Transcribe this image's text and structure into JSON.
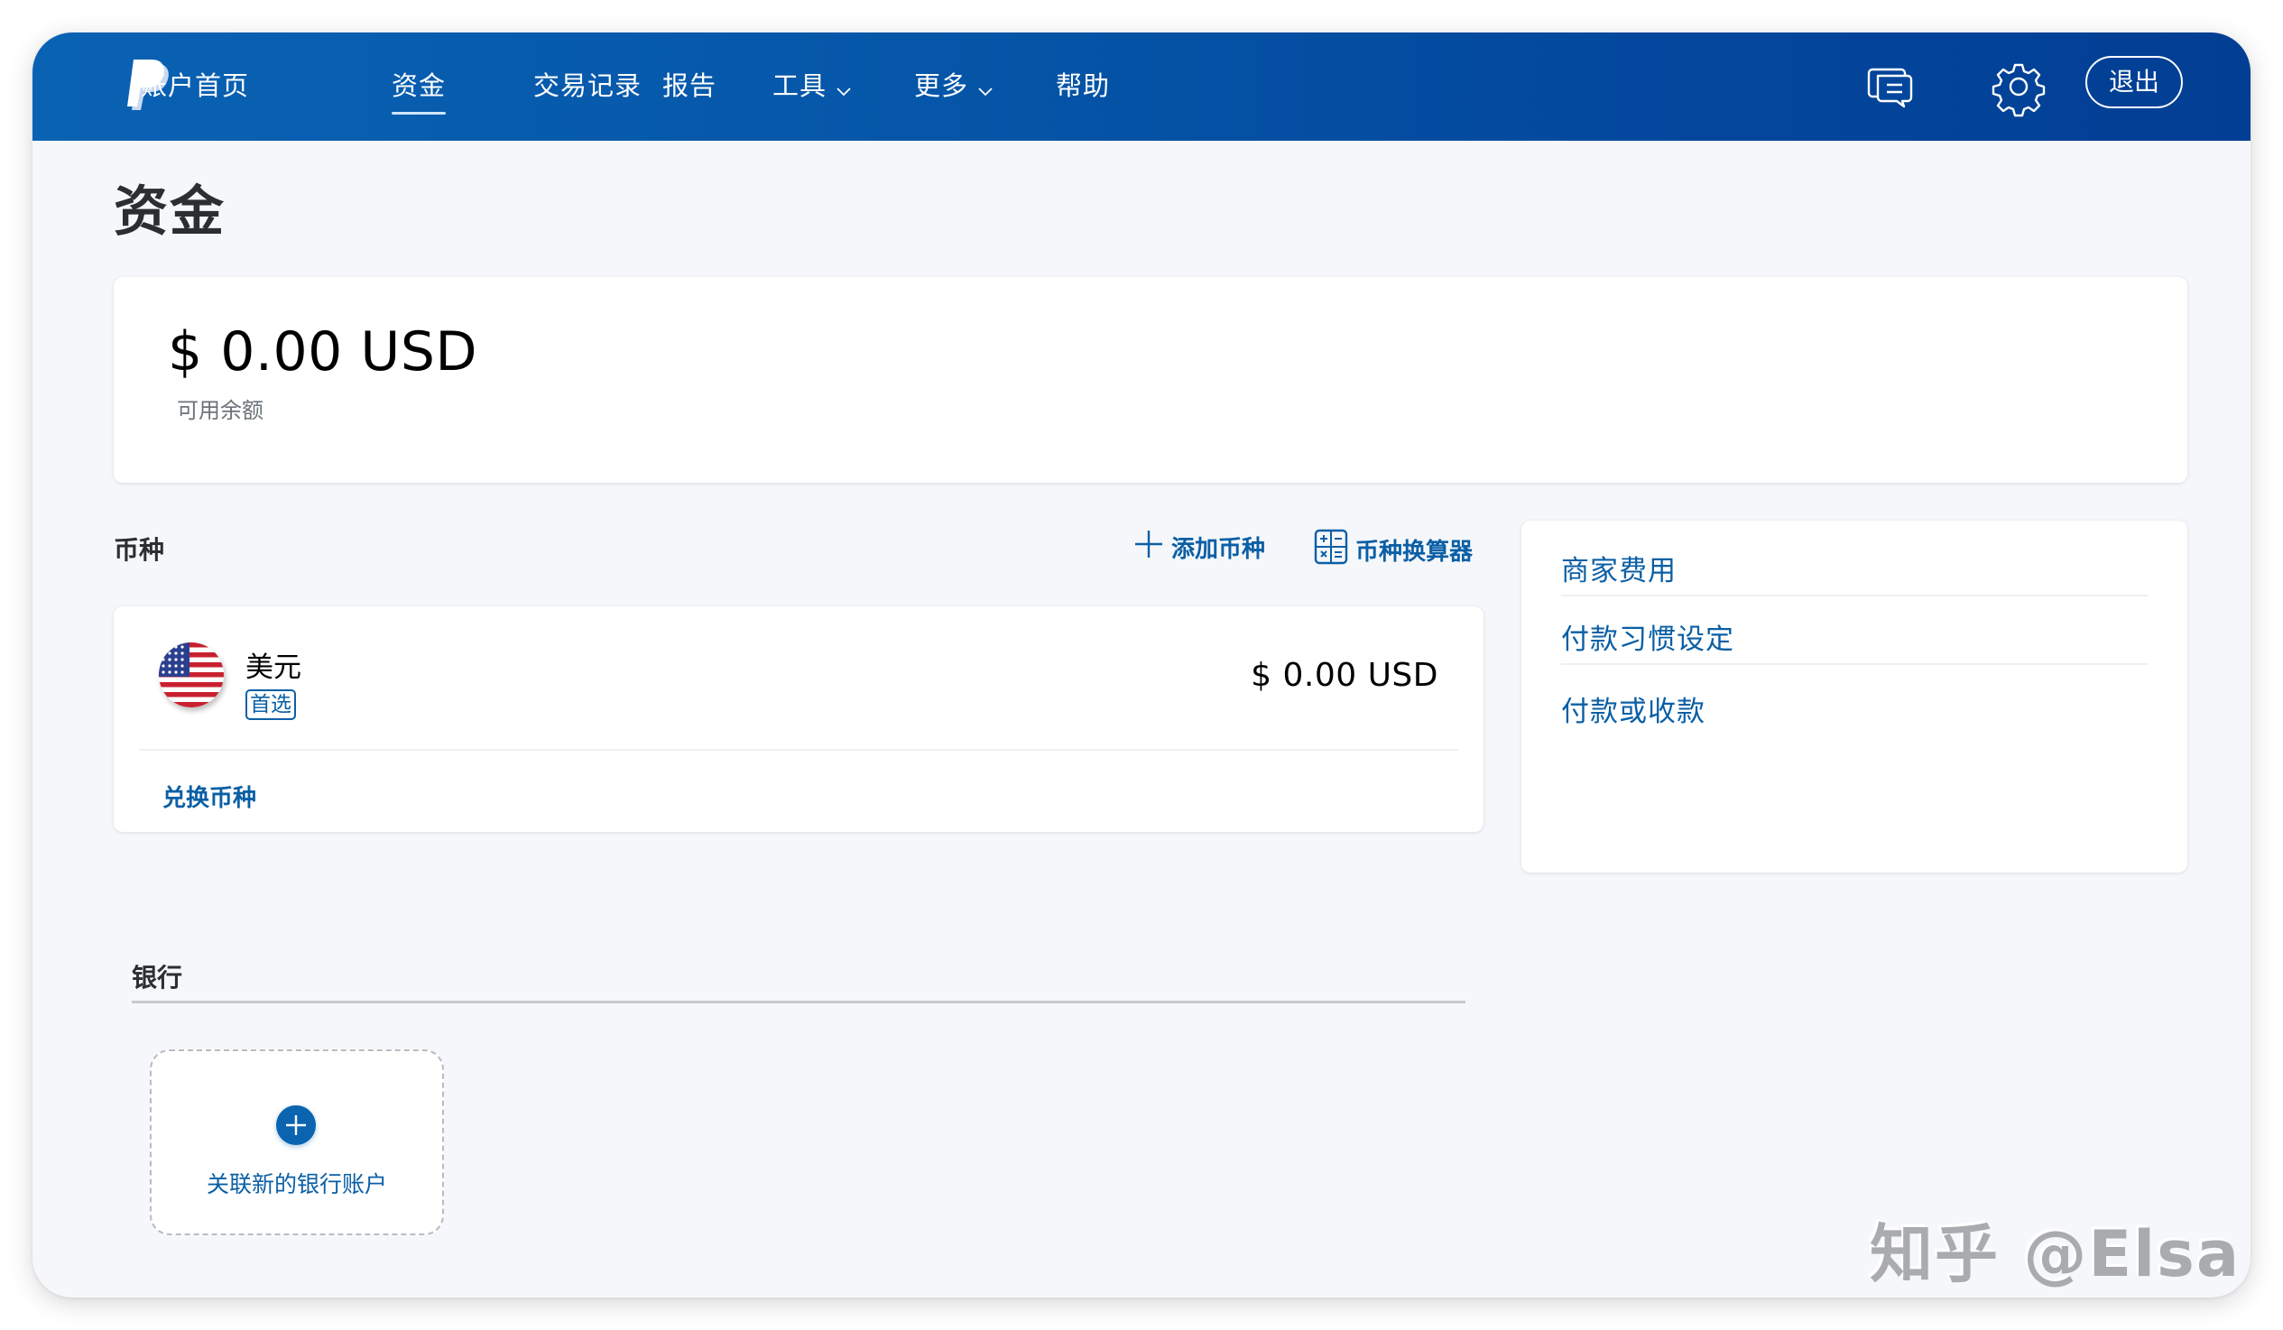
{
  "nav": {
    "brand": "PayPal",
    "items": [
      {
        "label": "账户首页",
        "active": false
      },
      {
        "label": "资金",
        "active": true
      },
      {
        "label": "交易记录",
        "active": false
      },
      {
        "label": "报告",
        "active": false
      },
      {
        "label": "工具",
        "active": false,
        "dropdown": true
      },
      {
        "label": "更多",
        "active": false,
        "dropdown": true
      },
      {
        "label": "帮助",
        "active": false
      }
    ],
    "icons": {
      "messages": "message-center-icon",
      "settings": "gear-icon"
    },
    "logout_label": "退出"
  },
  "page": {
    "title": "资金"
  },
  "balance": {
    "amount": "$ 0.00 USD",
    "label": "可用余额"
  },
  "currencies": {
    "heading": "币种",
    "add_label": "添加币种",
    "converter_label": "币种换算器",
    "items": [
      {
        "name": "美元",
        "badge": "首选",
        "amount": "$ 0.00 USD",
        "flag": "us-flag"
      }
    ],
    "convert_label": "兑换币种"
  },
  "side_links": [
    {
      "label": "商家费用"
    },
    {
      "label": "付款习惯设定"
    },
    {
      "label": "付款或收款"
    }
  ],
  "banks": {
    "heading": "银行",
    "add_label": "关联新的银行账户"
  },
  "watermark": "知乎 @Elsa",
  "colors": {
    "nav_start": "#0a62b3",
    "nav_end": "#023e94",
    "link": "#0a5fa5",
    "background": "#f5f7fa"
  }
}
